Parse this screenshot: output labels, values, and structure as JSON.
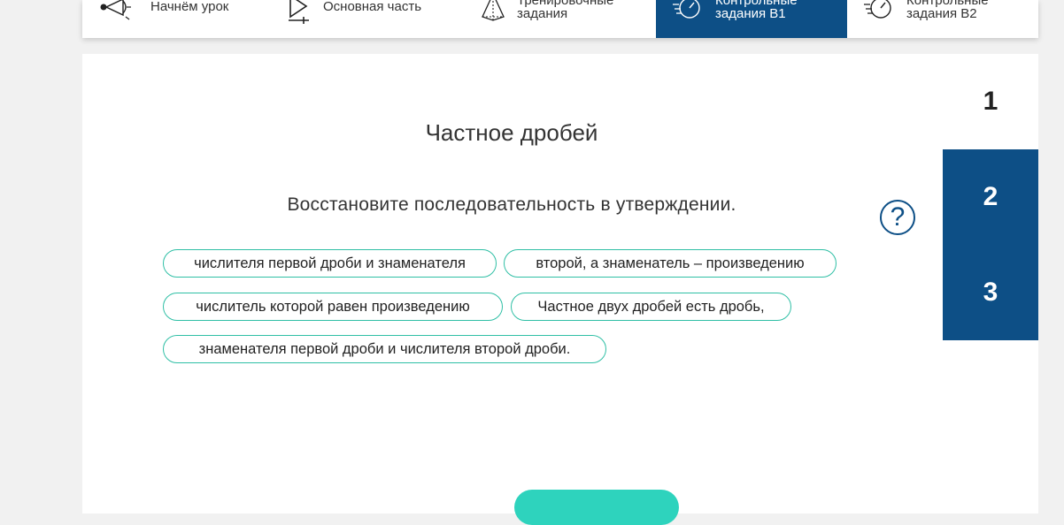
{
  "nav": {
    "items": [
      {
        "label": "Начнём урок",
        "icon": "megaphone-icon"
      },
      {
        "label": "Основная часть",
        "icon": "play-icon"
      },
      {
        "label": "Тренировочные задания",
        "icon": "target-icon"
      },
      {
        "label": "Контрольные задания В1",
        "icon": "stopwatch-icon"
      },
      {
        "label": "Контрольные задания В2",
        "icon": "stopwatch-icon"
      }
    ],
    "active_index": 3
  },
  "lesson": {
    "title": "Частное дробей",
    "instruction": "Восстановите последовательность в утверждении.",
    "help_symbol": "?",
    "chips": [
      "числителя первой дроби и знаменателя",
      "второй, а знаменатель – произведению",
      "числитель которой равен произведению",
      "Частное двух дробей есть дробь,",
      "знаменателя первой дроби и числителя второй дроби."
    ]
  },
  "steps": [
    "1",
    "2",
    "3"
  ],
  "colors": {
    "accent_blue": "#0d4f86",
    "chip_border": "#2fbfa5",
    "button_teal": "#2ed3bd",
    "page_bg": "#f1f1f1"
  }
}
